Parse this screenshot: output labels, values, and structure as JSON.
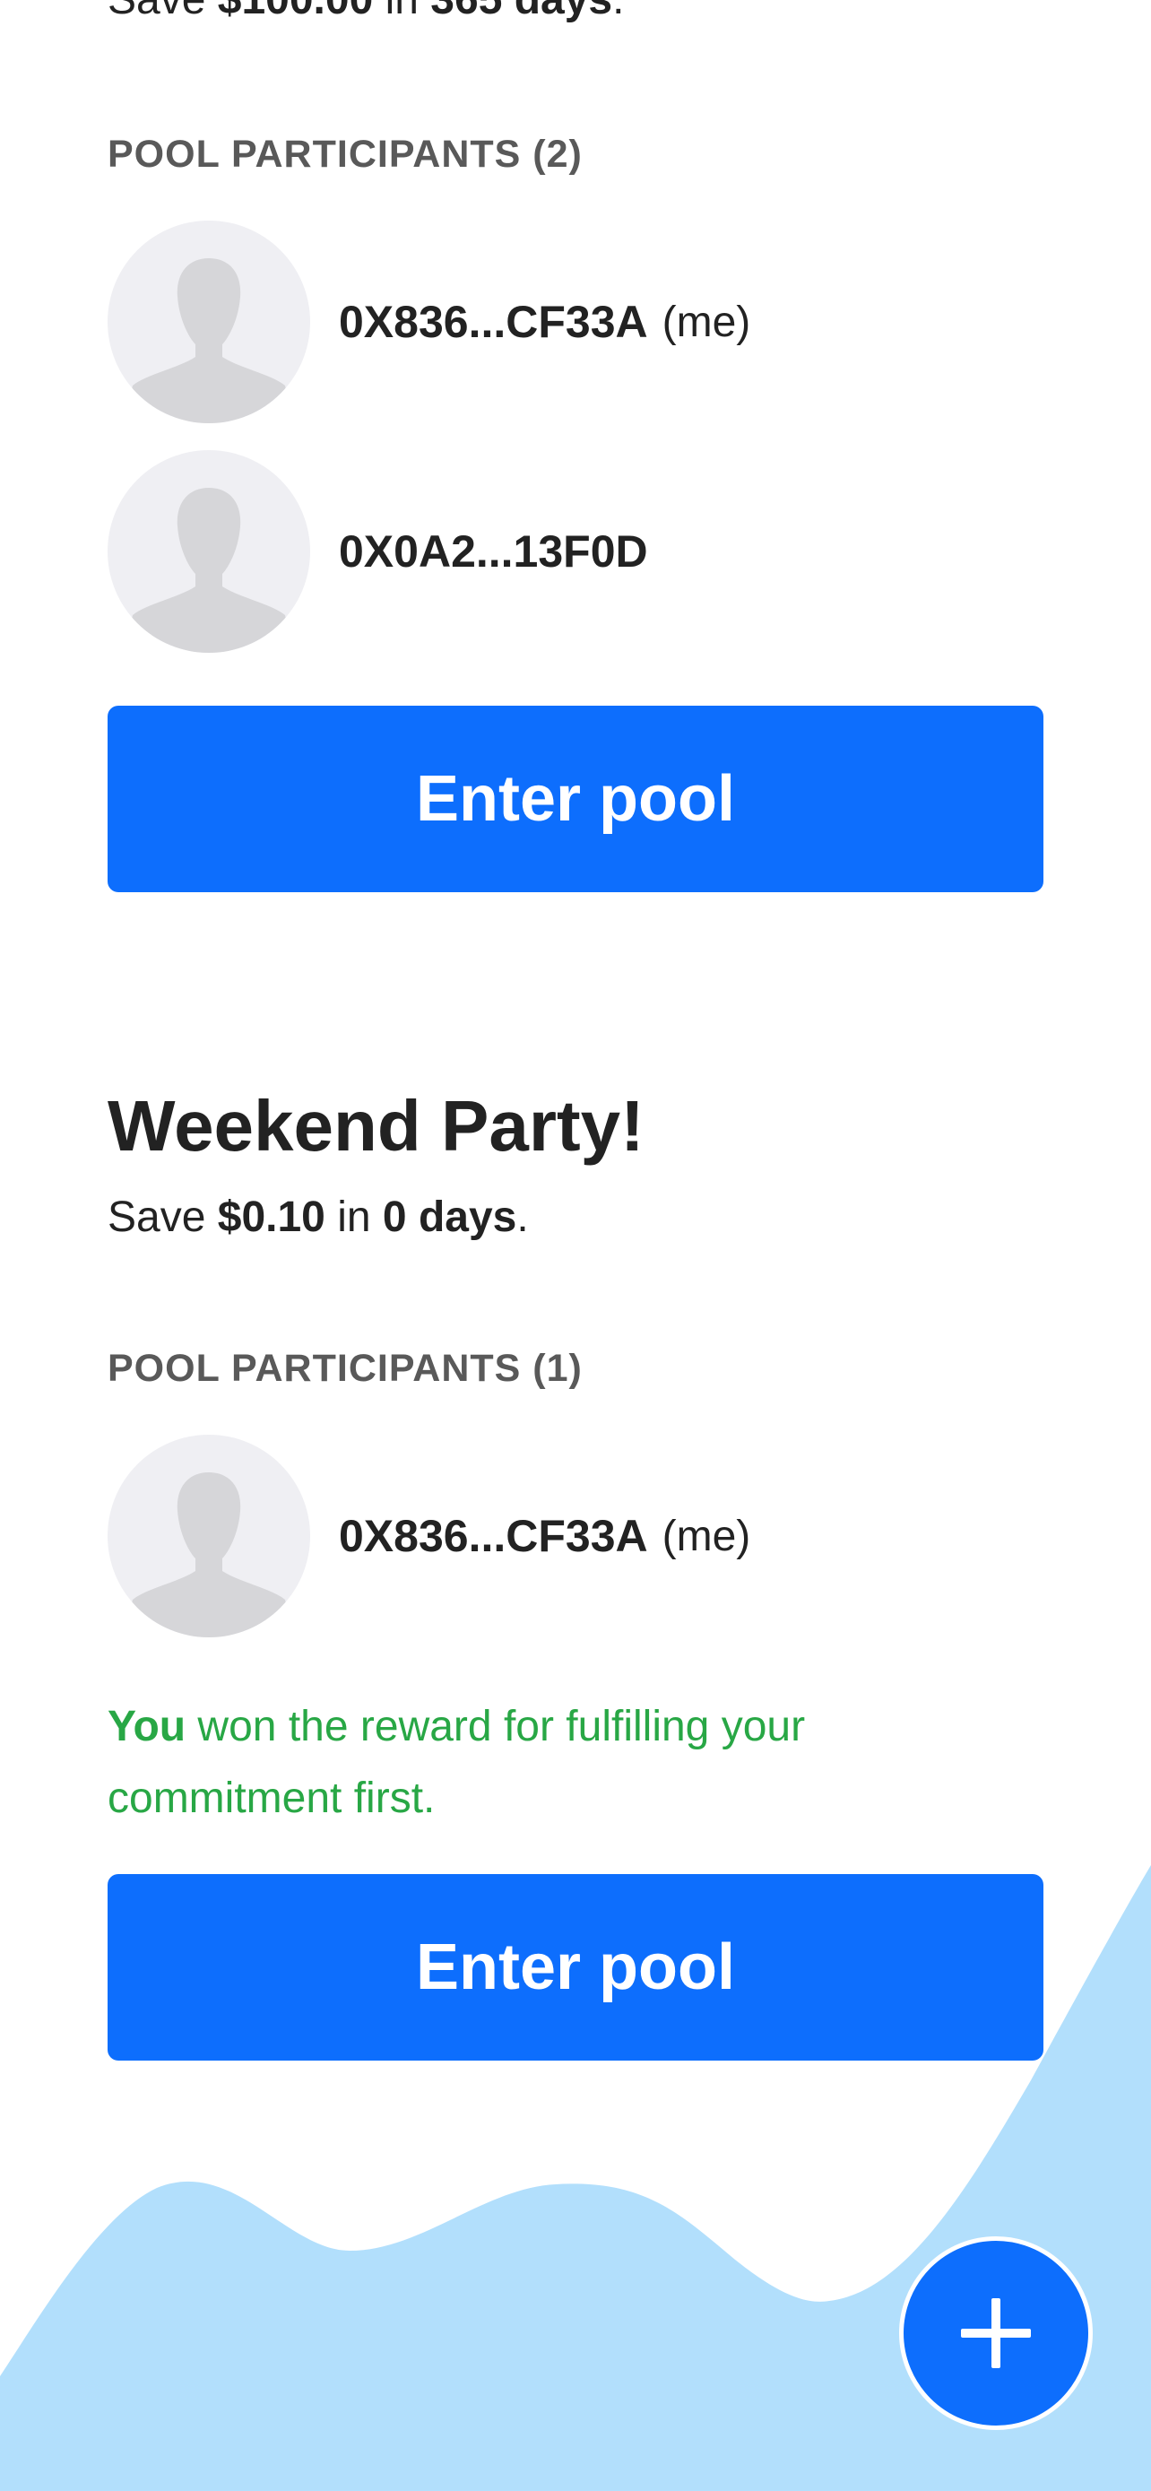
{
  "pools": [
    {
      "save_prefix": "Save ",
      "amount": "$100.00",
      "save_middle": " in ",
      "duration": "365 days",
      "save_suffix": ".",
      "participants_label": "POOL PARTICIPANTS (2)",
      "participants": [
        {
          "address": "0X836...CF33A",
          "me_label": "(me)"
        },
        {
          "address": "0X0A2...13F0D"
        }
      ],
      "enter_label": "Enter pool"
    },
    {
      "title": "Weekend Party!",
      "save_prefix": "Save ",
      "amount": "$0.10",
      "save_middle": " in ",
      "duration": "0 days",
      "save_suffix": ".",
      "participants_label": "POOL PARTICIPANTS (1)",
      "participants": [
        {
          "address": "0X836...CF33A",
          "me_label": "(me)"
        }
      ],
      "reward_winner": "You",
      "reward_message": " won the reward for fulfilling your commitment first.",
      "enter_label": "Enter pool"
    }
  ],
  "fab": {
    "icon": "plus-icon"
  },
  "colors": {
    "primary": "#0d6efd",
    "success": "#28a745",
    "wave": "#b2dffc",
    "label_gray": "#595959",
    "avatar_bg": "#efeff3",
    "avatar_silhouette": "#d6d6d9"
  }
}
